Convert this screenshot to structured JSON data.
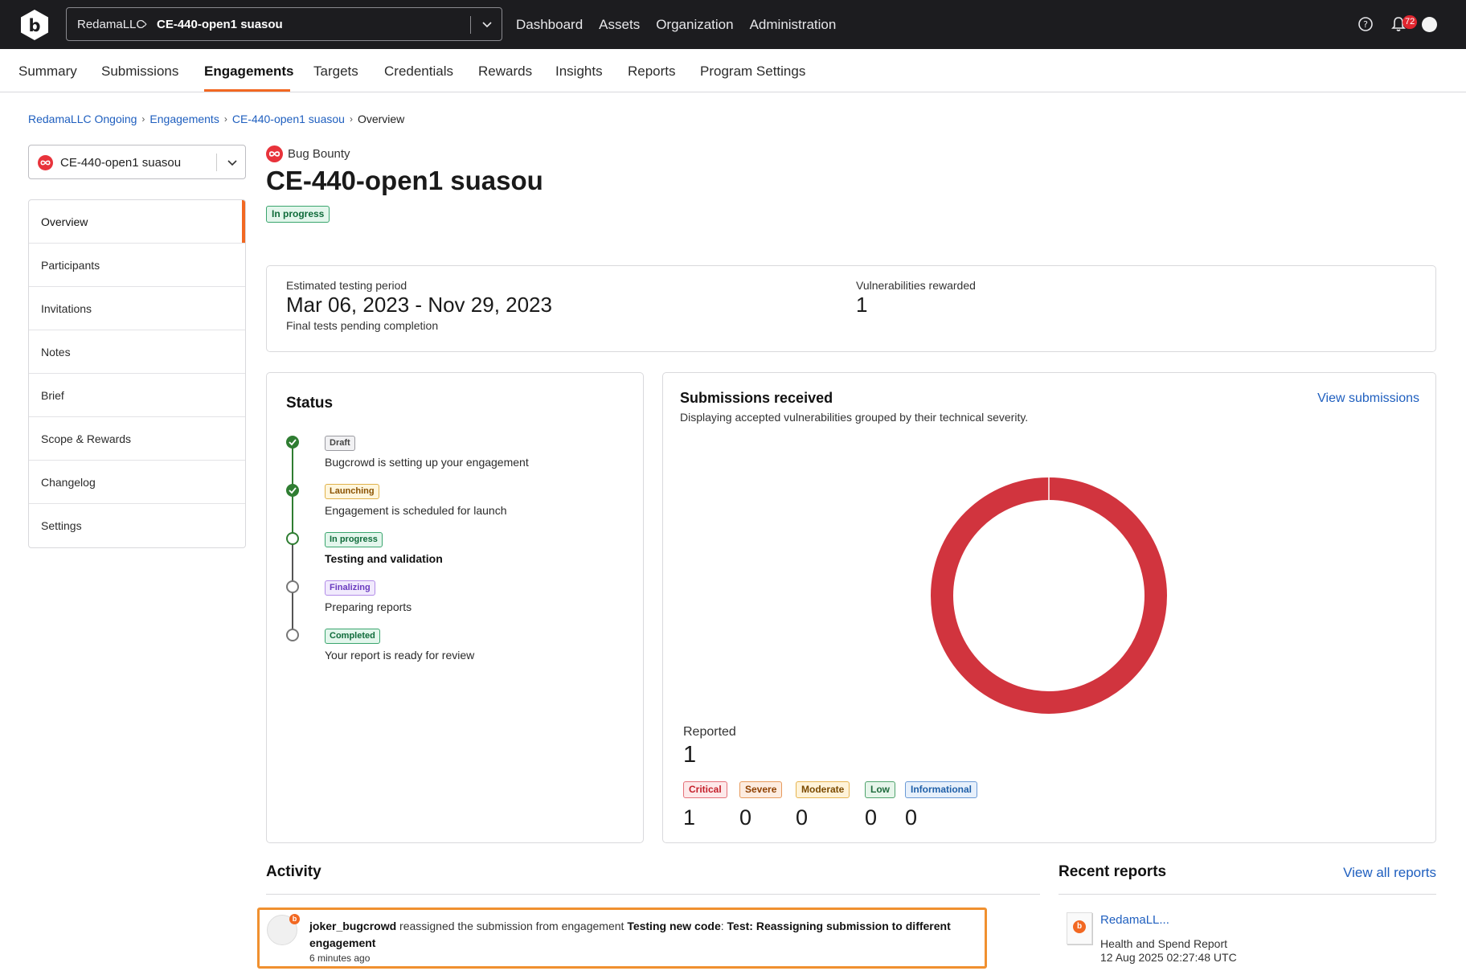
{
  "topbar": {
    "org": "RedamaLLC",
    "engagement": "CE-440-open1 suasou",
    "nav": [
      "Dashboard",
      "Assets",
      "Organization",
      "Administration"
    ],
    "notification_count": "72"
  },
  "subnav": {
    "items": [
      "Summary",
      "Submissions",
      "Engagements",
      "Targets",
      "Credentials",
      "Rewards",
      "Insights",
      "Reports",
      "Program Settings"
    ],
    "active": "Engagements"
  },
  "breadcrumb": {
    "items": [
      "RedamaLLC Ongoing",
      "Engagements",
      "CE-440-open1 suasou"
    ],
    "current": "Overview"
  },
  "engagement_select": {
    "value": "CE-440-open1 suasou"
  },
  "sidenav": {
    "items": [
      "Overview",
      "Participants",
      "Invitations",
      "Notes",
      "Brief",
      "Scope & Rewards",
      "Changelog",
      "Settings"
    ],
    "active": "Overview"
  },
  "header": {
    "type": "Bug Bounty",
    "title": "CE-440-open1 suasou",
    "status": "In progress"
  },
  "summary": {
    "period_label": "Estimated testing period",
    "period_value": "Mar 06, 2023 - Nov 29, 2023",
    "period_note": "Final tests pending completion",
    "rewarded_label": "Vulnerabilities rewarded",
    "rewarded_value": "1"
  },
  "status": {
    "title": "Status",
    "steps": [
      {
        "badge": "Draft",
        "text": "Bugcrowd is setting up your engagement",
        "state": "done"
      },
      {
        "badge": "Launching",
        "text": "Engagement is scheduled for launch",
        "state": "done"
      },
      {
        "badge": "In progress",
        "text": "Testing and validation",
        "state": "current"
      },
      {
        "badge": "Finalizing",
        "text": "Preparing reports",
        "state": "todo"
      },
      {
        "badge": "Completed",
        "text": "Your report is ready for review",
        "state": "todo"
      }
    ]
  },
  "submissions": {
    "title": "Submissions received",
    "description": "Displaying accepted vulnerabilities grouped by their technical severity.",
    "view_link": "View submissions",
    "reported_label": "Reported",
    "reported_value": "1",
    "severity": [
      {
        "label": "Critical",
        "value": "1",
        "color": "#d1343e"
      },
      {
        "label": "Severe",
        "value": "0",
        "color": "#e9803b"
      },
      {
        "label": "Moderate",
        "value": "0",
        "color": "#e6b450"
      },
      {
        "label": "Low",
        "value": "0",
        "color": "#4fa36d"
      },
      {
        "label": "Informational",
        "value": "0",
        "color": "#6a9ad6"
      }
    ]
  },
  "chart_data": {
    "type": "pie",
    "categories": [
      "Critical",
      "Severe",
      "Moderate",
      "Low",
      "Informational"
    ],
    "values": [
      1,
      0,
      0,
      0,
      0
    ],
    "style": "donut",
    "colors": [
      "#d1343e",
      "#e9803b",
      "#e6b450",
      "#4fa36d",
      "#6a9ad6"
    ]
  },
  "activity": {
    "title": "Activity",
    "items": [
      {
        "user": "joker_bugcrowd",
        "action": "reassigned the submission from engagement",
        "engagement": "Testing new code",
        "submission": "Test: Reassigning submission to different engagement",
        "time": "6 minutes ago"
      }
    ]
  },
  "reports": {
    "title": "Recent reports",
    "view_link": "View all reports",
    "items": [
      {
        "name": "RedamaLL...",
        "type": "Health and Spend Report",
        "date": "12 Aug 2025 02:27:48 UTC"
      }
    ]
  },
  "colors": {
    "accent": "#f26822",
    "link": "#1f5fbf",
    "topbar_bg": "#1c1c1f",
    "critical": "#d1343e",
    "success": "#2f7d32"
  }
}
